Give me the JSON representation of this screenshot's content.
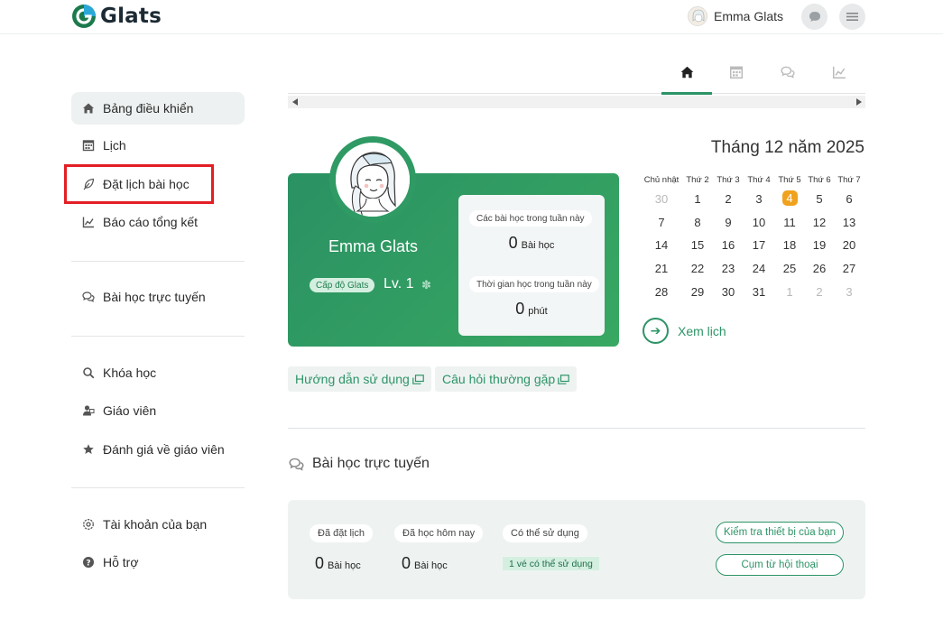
{
  "brand": {
    "name": "Glats"
  },
  "header": {
    "user_name": "Emma Glats"
  },
  "sidebar": {
    "items": [
      {
        "label": "Bảng điều khiển",
        "icon": "home-icon"
      },
      {
        "label": "Lịch",
        "icon": "calendar-icon"
      },
      {
        "label": "Đặt lịch bài học",
        "icon": "feather-icon"
      },
      {
        "label": "Báo cáo tổng kết",
        "icon": "chart-icon"
      },
      {
        "label": "Bài học trực tuyến",
        "icon": "chat-icon"
      },
      {
        "label": "Khóa học",
        "icon": "search-icon"
      },
      {
        "label": "Giáo viên",
        "icon": "teacher-icon"
      },
      {
        "label": "Đánh giá về giáo viên",
        "icon": "star-icon"
      },
      {
        "label": "Tài khoản của bạn",
        "icon": "gear-icon"
      },
      {
        "label": "Hỗ trợ",
        "icon": "help-icon"
      }
    ]
  },
  "tabs": [
    {
      "name": "home-tab",
      "icon": "home-icon"
    },
    {
      "name": "calendar-tab",
      "icon": "calendar-icon"
    },
    {
      "name": "chat-tab",
      "icon": "chat-icon"
    },
    {
      "name": "report-tab",
      "icon": "chart-icon"
    }
  ],
  "profile": {
    "name": "Emma Glats",
    "level_badge": "Cấp độ Glats",
    "level": "Lv. 1",
    "stats": {
      "weekly_lessons_label": "Các bài học trong tuần này",
      "weekly_lessons_value": "0",
      "weekly_lessons_unit": "Bài học",
      "weekly_time_label": "Thời gian học trong tuần này",
      "weekly_time_value": "0",
      "weekly_time_unit": "phút"
    }
  },
  "calendar": {
    "title": "Tháng 12 năm 2025",
    "weekdays": [
      "Chủ nhật",
      "Thứ 2",
      "Thứ 3",
      "Thứ 4",
      "Thứ 5",
      "Thứ 6",
      "Thứ 7"
    ],
    "weeks": [
      [
        "30",
        "1",
        "2",
        "3",
        "4",
        "5",
        "6"
      ],
      [
        "7",
        "8",
        "9",
        "10",
        "11",
        "12",
        "13"
      ],
      [
        "14",
        "15",
        "16",
        "17",
        "18",
        "19",
        "20"
      ],
      [
        "21",
        "22",
        "23",
        "24",
        "25",
        "26",
        "27"
      ],
      [
        "28",
        "29",
        "30",
        "31",
        "1",
        "2",
        "3"
      ]
    ],
    "today": "4",
    "see_calendar": "Xem lịch"
  },
  "help": {
    "guide": "Hướng dẫn sử dụng",
    "faq": "Câu hỏi thường gặp"
  },
  "online": {
    "title": "Bài học trực tuyến",
    "booked_label": "Đã đặt lịch",
    "booked_value": "0",
    "booked_unit": "Bài học",
    "today_label": "Đã học hôm nay",
    "today_value": "0",
    "today_unit": "Bài học",
    "available_label": "Có thể sử dụng",
    "available_tag": "1 vé có thể sử dụng",
    "check_device": "Kiểm tra thiết bị của bạn",
    "phrases": "Cụm từ hội thoại"
  },
  "colors": {
    "accent": "#2d9467",
    "today": "#f0a21e",
    "highlight": "#e31e24"
  }
}
